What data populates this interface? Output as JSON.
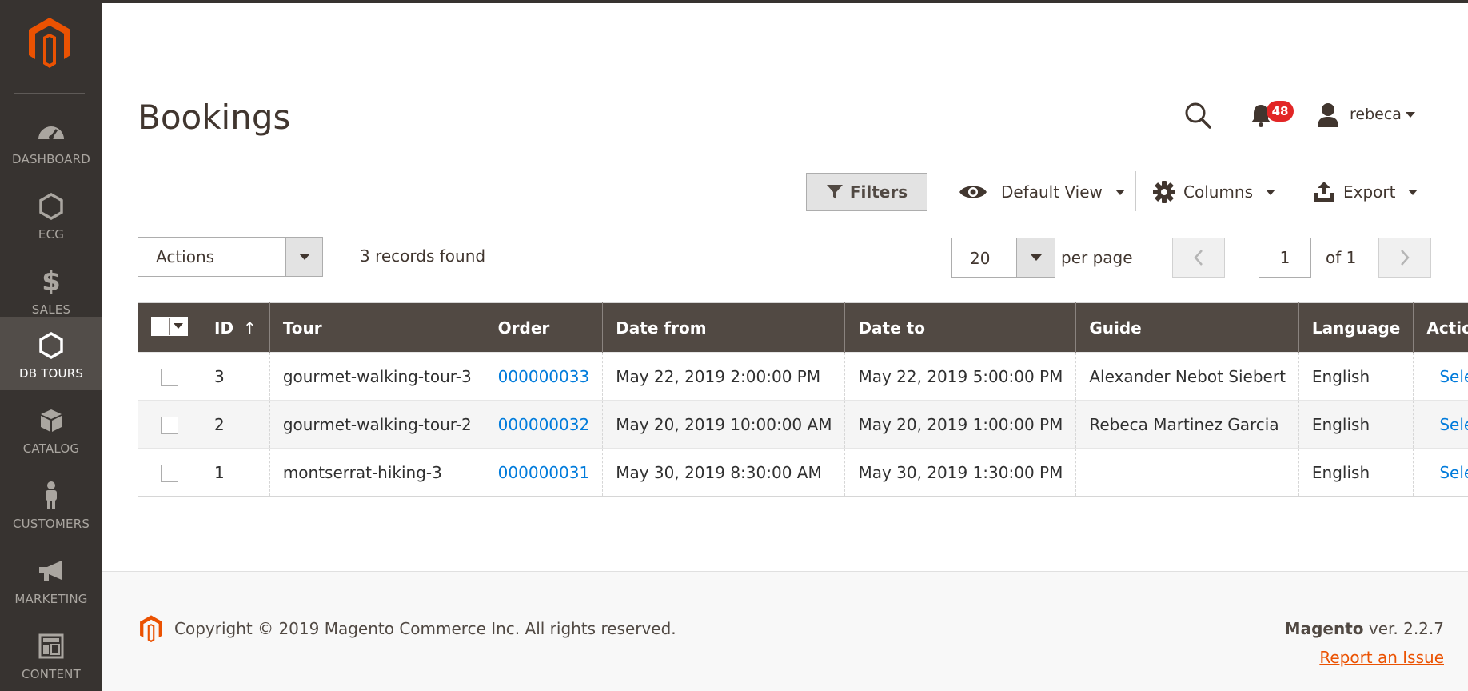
{
  "colors": {
    "sidebar": "#373330",
    "accent": "#eb5202",
    "link": "#007bdb",
    "badge": "#e22626",
    "grid_header": "#514943"
  },
  "sidebar": {
    "logo": "magento-logo",
    "items": [
      {
        "label": "DASHBOARD",
        "icon": "dashboard-icon",
        "active": false
      },
      {
        "label": "ECG",
        "icon": "hexagon-icon",
        "active": false
      },
      {
        "label": "SALES",
        "icon": "dollar-icon",
        "active": false
      },
      {
        "label": "DB TOURS",
        "icon": "hexagon-icon",
        "active": true
      },
      {
        "label": "CATALOG",
        "icon": "box-icon",
        "active": false
      },
      {
        "label": "CUSTOMERS",
        "icon": "person-icon",
        "active": false
      },
      {
        "label": "MARKETING",
        "icon": "megaphone-icon",
        "active": false
      },
      {
        "label": "CONTENT",
        "icon": "layout-icon",
        "active": false
      }
    ]
  },
  "header": {
    "title": "Bookings",
    "notifications_count": "48",
    "user_name": "rebeca"
  },
  "toolbar": {
    "filters_label": "Filters",
    "view_label": "Default View",
    "columns_label": "Columns",
    "export_label": "Export"
  },
  "controls": {
    "actions_label": "Actions",
    "records_text": "3 records found",
    "per_page_value": "20",
    "per_page_label": "per page",
    "page_value": "1",
    "page_of": "of 1"
  },
  "grid": {
    "columns": [
      "ID",
      "Tour",
      "Order",
      "Date from",
      "Date to",
      "Guide",
      "Language",
      "Action"
    ],
    "sort_indicator": "↑",
    "rows": [
      {
        "id": "3",
        "tour": "gourmet-walking-tour-3",
        "order": "000000033",
        "date_from": "May 22, 2019 2:00:00 PM",
        "date_to": "May 22, 2019 5:00:00 PM",
        "guide": "Alexander Nebot Siebert",
        "language": "English",
        "action": "Select"
      },
      {
        "id": "2",
        "tour": "gourmet-walking-tour-2",
        "order": "000000032",
        "date_from": "May 20, 2019 10:00:00 AM",
        "date_to": "May 20, 2019 1:00:00 PM",
        "guide": "Rebeca Martinez Garcia",
        "language": "English",
        "action": "Select"
      },
      {
        "id": "1",
        "tour": "montserrat-hiking-3",
        "order": "000000031",
        "date_from": "May 30, 2019 8:30:00 AM",
        "date_to": "May 30, 2019 1:30:00 PM",
        "guide": "",
        "language": "English",
        "action": "Select"
      }
    ]
  },
  "footer": {
    "copyright": "Copyright © 2019 Magento Commerce Inc. All rights reserved.",
    "brand": "Magento",
    "version": " ver. 2.2.7",
    "report_link": "Report an Issue"
  }
}
